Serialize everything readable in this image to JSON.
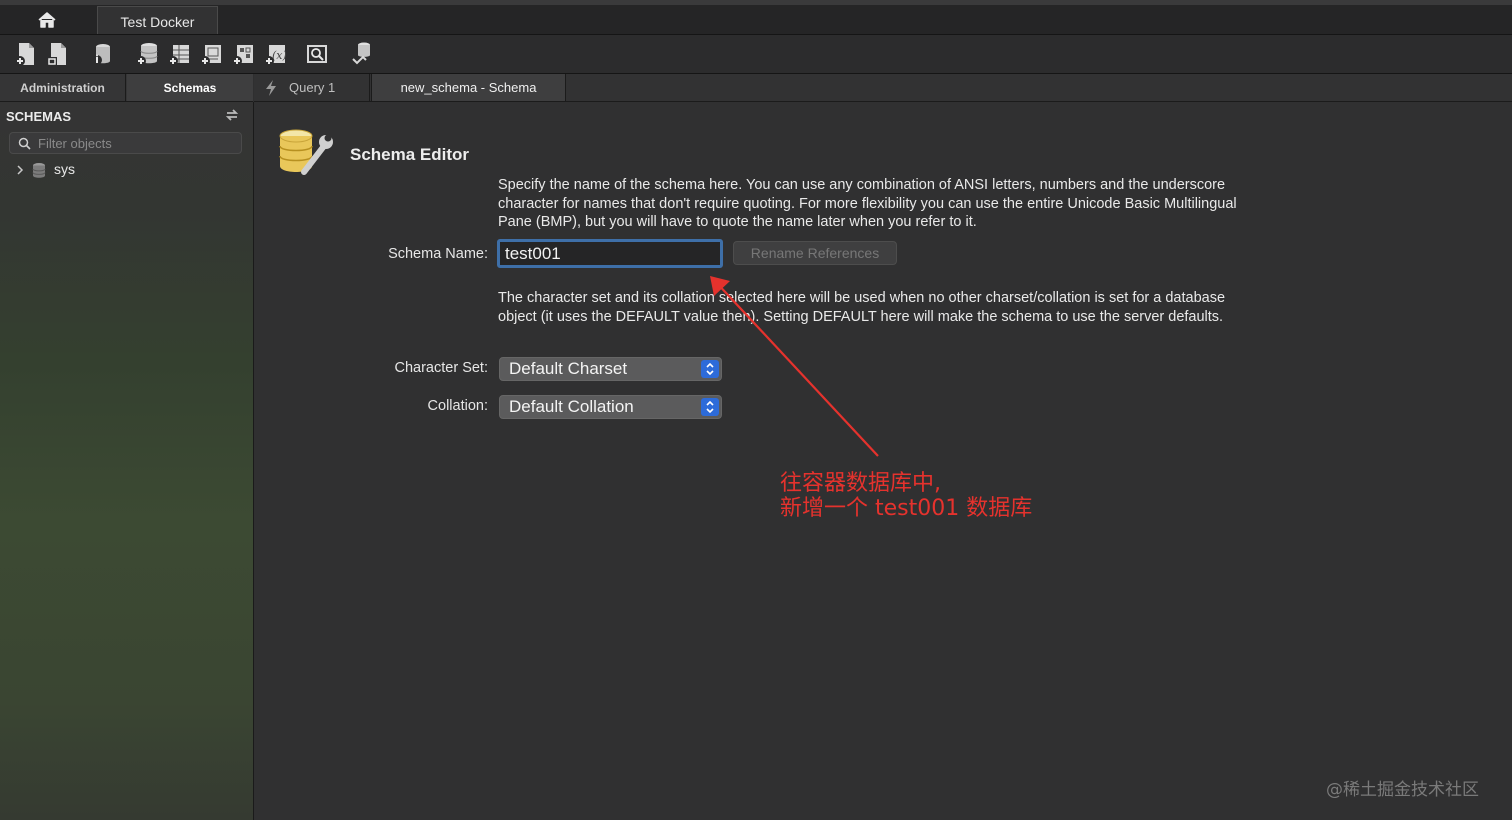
{
  "window": {
    "connection_tab": "Test Docker"
  },
  "toolbar": {
    "icons": [
      "new-sql-tab-icon",
      "open-sql-script-icon",
      "schema-inspector-icon",
      "create-schema-icon",
      "create-table-icon",
      "create-view-icon",
      "create-procedure-icon",
      "create-function-icon",
      "search-table-data-icon",
      "reconnect-icon"
    ]
  },
  "left_tabs": {
    "administration": "Administration",
    "schemas": "Schemas"
  },
  "editor_tabs": {
    "query": "Query 1",
    "schema": "new_schema - Schema"
  },
  "sidebar": {
    "header": "SCHEMAS",
    "filter_placeholder": "Filter objects",
    "tree": [
      {
        "label": "sys"
      }
    ]
  },
  "editor": {
    "title": "Schema Editor",
    "description_name": "Specify the name of the schema here. You can use any combination of ANSI letters, numbers and the underscore character for names that don't require quoting. For more flexibility you can use the entire Unicode Basic Multilingual Pane (BMP), but you will have to quote the name later when you refer to it.",
    "schema_name_label": "Schema Name:",
    "schema_name_value": "test001",
    "rename_button": "Rename References",
    "description_charset": "The character set and its collation selected here will be used when no other charset/collation is set for a database object (it uses the DEFAULT value then). Setting DEFAULT here will make the schema to use the server defaults.",
    "charset_label": "Character Set:",
    "charset_value": "Default Charset",
    "collation_label": "Collation:",
    "collation_value": "Default Collation"
  },
  "annotation": {
    "line1": "往容器数据库中,",
    "line2": "新增一个 test001 数据库",
    "color": "#e5322d"
  },
  "watermark": "@稀土掘金技术社区",
  "colors": {
    "accent": "#3e6fa8",
    "stepper": "#2d6bd9",
    "background": "#303031"
  }
}
